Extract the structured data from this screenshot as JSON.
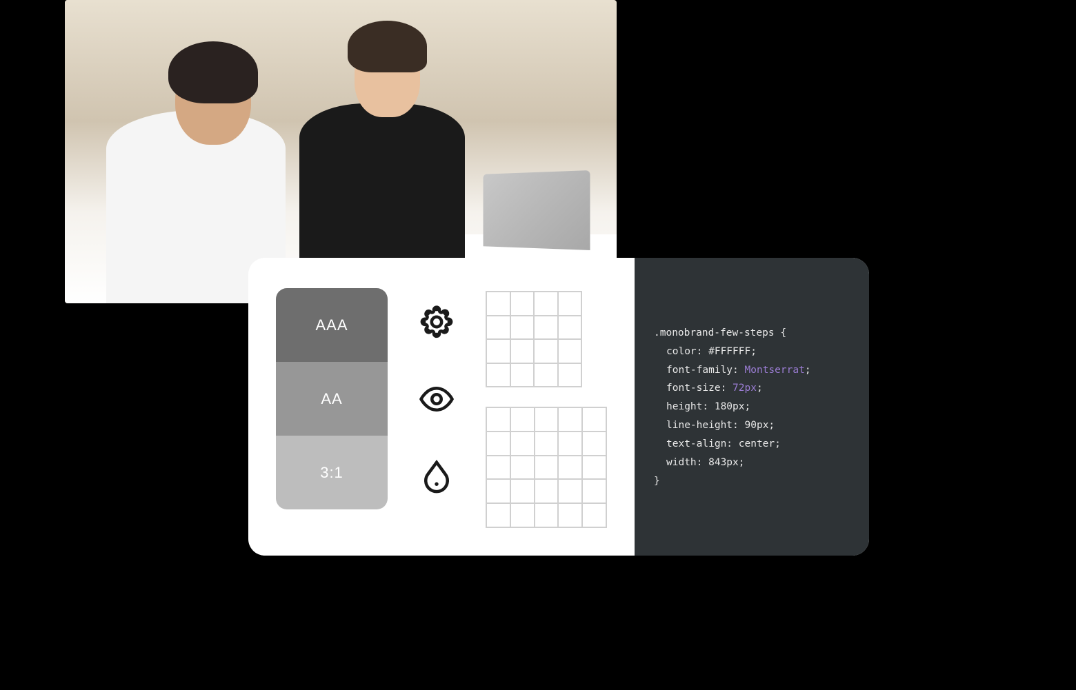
{
  "contrast": {
    "aaa": "AAA",
    "aa": "AA",
    "ratio": "3:1"
  },
  "icons": {
    "gear": "gear-icon",
    "eye": "eye-icon",
    "droplet": "droplet-icon"
  },
  "code": {
    "selector": ".monobrand-few-steps {",
    "properties": [
      {
        "key": "color",
        "value": "#FFFFFF",
        "highlight": false
      },
      {
        "key": "font-family",
        "value": "Montserrat",
        "highlight": true
      },
      {
        "key": "font-size",
        "value": "72px",
        "highlight": true
      },
      {
        "key": "height",
        "value": "180px",
        "highlight": false
      },
      {
        "key": "line-height",
        "value": "90px",
        "highlight": false
      },
      {
        "key": "text-align",
        "value": "center",
        "highlight": false
      },
      {
        "key": "width",
        "value": "843px",
        "highlight": false
      }
    ],
    "close": "}"
  }
}
